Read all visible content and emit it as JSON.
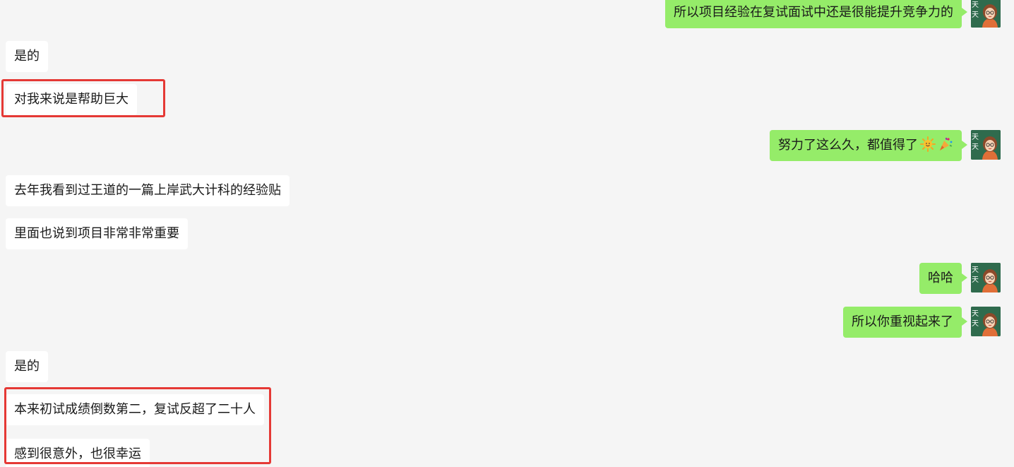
{
  "messages": [
    {
      "text": "所以项目经验在复试面试中还是很能提升竞争力的"
    },
    {
      "text": "是的"
    },
    {
      "text": "对我来说是帮助巨大"
    },
    {
      "text": "努力了这么久，都值得了"
    },
    {
      "text": "去年我看到过王道的一篇上岸武大计科的经验贴"
    },
    {
      "text": "里面也说到项目非常非常重要"
    },
    {
      "text": "哈哈"
    },
    {
      "text": "所以你重视起来了"
    },
    {
      "text": "是的"
    },
    {
      "text": "本来初试成绩倒数第二，复试反超了二十人"
    },
    {
      "text": "感到很意外，也很幸运"
    }
  ],
  "avatar_text": "天天",
  "emojis": [
    "sun-emoji",
    "party-popper-emoji"
  ],
  "colors": {
    "background": "#f5f5f5",
    "incoming_bubble": "#ffffff",
    "outgoing_bubble": "#95ec69",
    "highlight": "#e53935",
    "avatar_bg": "#2f6b4d"
  }
}
